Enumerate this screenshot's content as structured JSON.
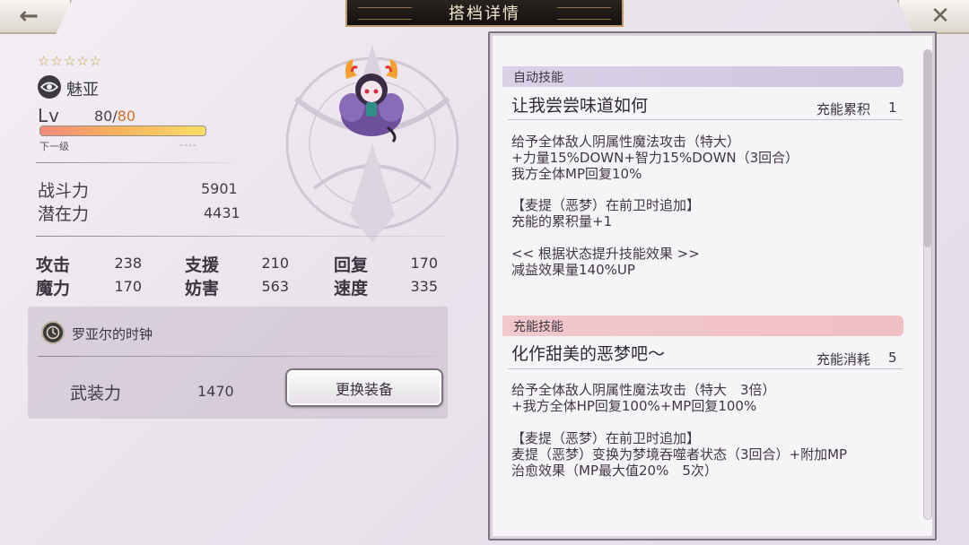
{
  "header": {
    "title": "搭档详情",
    "back_icon": "←",
    "close_icon": "✕"
  },
  "character": {
    "stars": "☆☆☆☆☆",
    "name": "魅亚",
    "lv_label": "Lv",
    "level": "80/",
    "level_max": "80",
    "xp_progress": 1.0,
    "next_label": "下一级",
    "next_value": "----",
    "combat_power_label": "战斗力",
    "combat_power": "5901",
    "potential_label": "潜在力",
    "potential": "4431"
  },
  "stats": [
    {
      "label": "攻击",
      "value": "238"
    },
    {
      "label": "支援",
      "value": "210"
    },
    {
      "label": "回复",
      "value": "170"
    },
    {
      "label": "魔力",
      "value": "170"
    },
    {
      "label": "妨害",
      "value": "563"
    },
    {
      "label": "速度",
      "value": "335"
    }
  ],
  "equipment": {
    "name": "罗亚尔的时钟",
    "armament_label": "武装力",
    "armament_value": "1470",
    "change_button": "更换装备"
  },
  "skills": {
    "auto": {
      "section": "自动技能",
      "name": "让我尝尝味道如何",
      "meta_label": "充能累积",
      "meta_value": "1",
      "desc1": "给予全体敌人阴属性魔法攻击（特大）\n+力量15%DOWN+智力15%DOWN（3回合）\n我方全体MP回复10%",
      "desc2": "【麦提（恶梦）在前卫时追加】\n充能的累积量+1",
      "desc3": "<< 根据状态提升技能效果 >>\n减益效果量140%UP"
    },
    "charge": {
      "section": "充能技能",
      "name": "化作甜美的恶梦吧～",
      "meta_label": "充能消耗",
      "meta_value": "5",
      "desc1": "给予全体敌人阴属性魔法攻击（特大　3倍）\n+我方全体HP回复100%+MP回复100%",
      "desc2": "【麦提（恶梦）在前卫时追加】\n麦提（恶梦）变换为梦境吞噬者状态（3回合）+附加MP\n治愈效果（MP最大值20%　5次）"
    }
  },
  "colors": {
    "accent_gold": "#b99a62",
    "level_max": "#d0722b",
    "auto_section": "#d9d1e6",
    "charge_section": "#f2c8cc"
  }
}
